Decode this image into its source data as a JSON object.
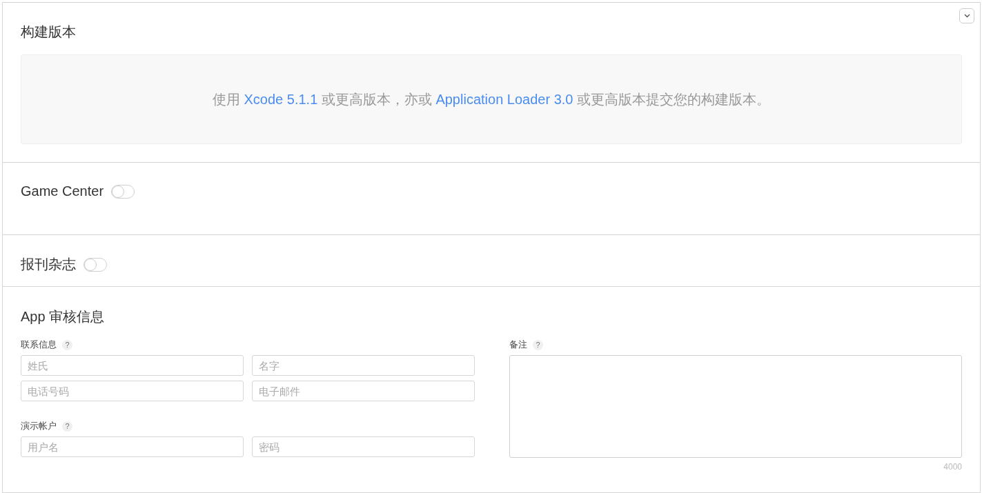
{
  "build": {
    "title": "构建版本",
    "message": [
      {
        "text": "使用 ",
        "link": false
      },
      {
        "text": "Xcode 5.1.1",
        "link": true
      },
      {
        "text": " 或更高版本，亦或 ",
        "link": false
      },
      {
        "text": "Application Loader 3.0",
        "link": true
      },
      {
        "text": " 或更高版本提交您的构建版本。",
        "link": false
      }
    ]
  },
  "toggles": [
    {
      "label": "Game Center",
      "on": false
    },
    {
      "label": "报刊杂志",
      "on": false
    }
  ],
  "review": {
    "title": "App 审核信息",
    "contact": {
      "label": "联系信息",
      "help": "?",
      "fields": [
        {
          "placeholder": "姓氏"
        },
        {
          "placeholder": "名字"
        },
        {
          "placeholder": "电话号码"
        },
        {
          "placeholder": "电子邮件"
        }
      ]
    },
    "demo": {
      "label": "演示帐户",
      "help": "?",
      "fields": [
        {
          "placeholder": "用户名"
        },
        {
          "placeholder": "密码"
        }
      ]
    },
    "notes": {
      "label": "备注",
      "help": "?",
      "counter": "4000"
    }
  }
}
